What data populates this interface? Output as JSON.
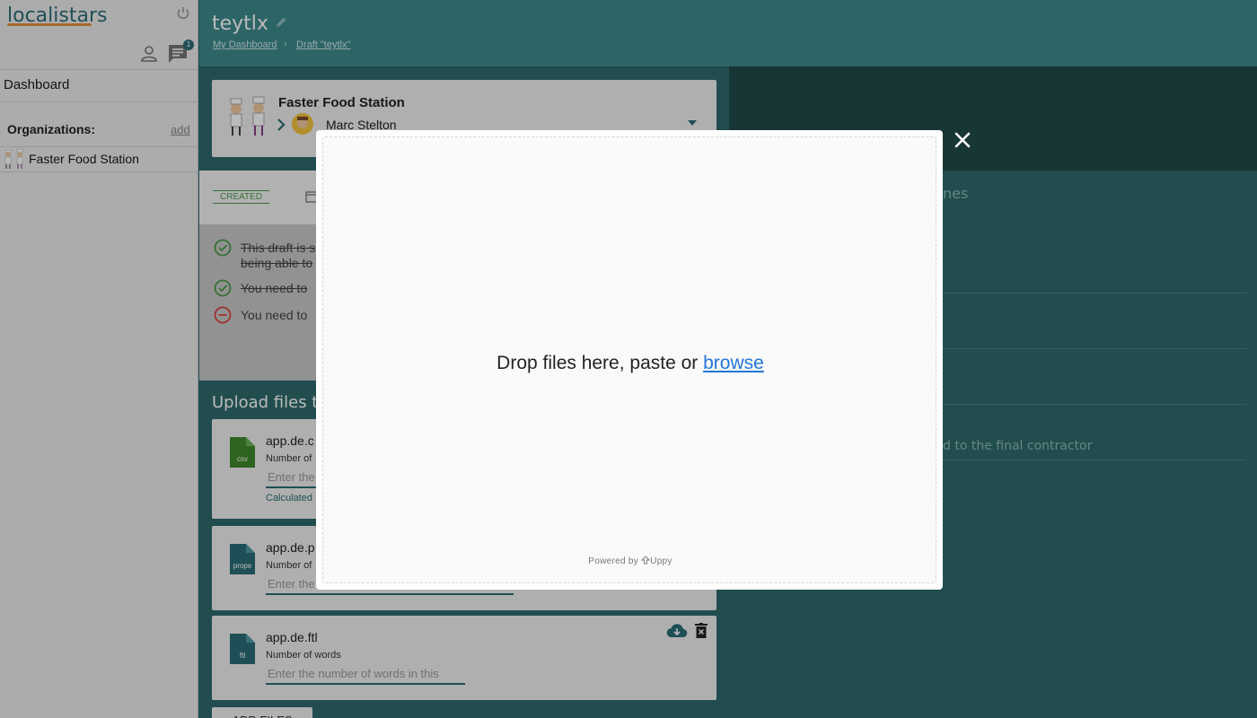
{
  "sidebar": {
    "logo": "localistars",
    "notification_count": "1",
    "nav": {
      "dashboard": "Dashboard"
    },
    "organizations": {
      "title": "Organizations:",
      "add_label": "add",
      "items": [
        {
          "label": "Faster Food Station"
        }
      ]
    }
  },
  "header": {
    "title": "teytlx",
    "breadcrumbs": [
      "My Dashboard",
      "Draft \"teytlx\""
    ],
    "separator": "›"
  },
  "team": {
    "org_name": "Faster Food Station",
    "person": "Marc Stelton"
  },
  "status": {
    "badge": "CREATED"
  },
  "checklist": [
    {
      "text": "This draft is s",
      "text2": "being able to",
      "state": "done"
    },
    {
      "text": "You need to",
      "state": "done"
    },
    {
      "text": "You need to",
      "state": "missing"
    }
  ],
  "upload": {
    "heading": "Upload files to",
    "files": [
      {
        "name": "app.de.c",
        "type_label": "csv",
        "field_label": "Number of",
        "placeholder": "Enter the",
        "calc_note": "Calculated",
        "color": "#3f8a2c"
      },
      {
        "name": "app.de.p",
        "type_label": "prope",
        "field_label": "Number of",
        "placeholder": "Enter the",
        "calc_note": "",
        "color": "#2b6d76"
      },
      {
        "name": "app.de.ftl",
        "type_label": "ftl",
        "field_label": "Number of words",
        "placeholder": "Enter the number of words in this",
        "calc_note": "",
        "color": "#2b6d76"
      }
    ],
    "add_files_label": "ADD FILES"
  },
  "right_panel": {
    "heading_fragment": "nes",
    "note_fragment": "d to the final contractor"
  },
  "modal": {
    "drop_text": "Drop files here, paste or ",
    "browse_label": "browse",
    "powered_by": "Powered by",
    "brand": "Uppy"
  },
  "colors": {
    "accent": "#2b6d76",
    "header_bg": "#3e8b8c",
    "link": "#2275d7",
    "success": "#4a9a4a",
    "error": "#d9433f"
  }
}
